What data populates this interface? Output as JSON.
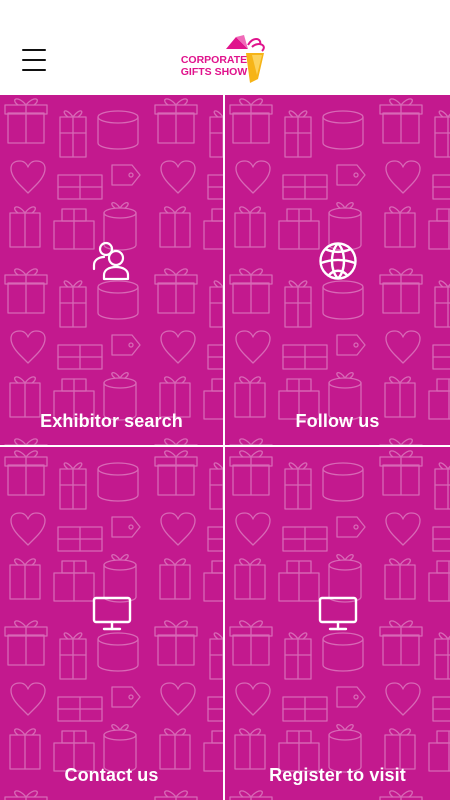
{
  "header": {
    "menu_icon": "hamburger-menu-icon",
    "logo": {
      "line1": "CORPORATE",
      "line2": "GIFTS SHOW"
    }
  },
  "colors": {
    "tile_background": "#c3198e",
    "tile_pattern": "#d868b6",
    "divider": "#ffffff",
    "label": "#ffffff",
    "logo_pink": "#e0138c",
    "logo_yellow": "#f6b417"
  },
  "tiles": [
    {
      "label": "Exhibitor search",
      "icon": "people-search-icon"
    },
    {
      "label": "Follow us",
      "icon": "globe-icon"
    },
    {
      "label": "Contact us",
      "icon": "monitor-icon"
    },
    {
      "label": "Register to visit",
      "icon": "monitor-icon"
    }
  ]
}
